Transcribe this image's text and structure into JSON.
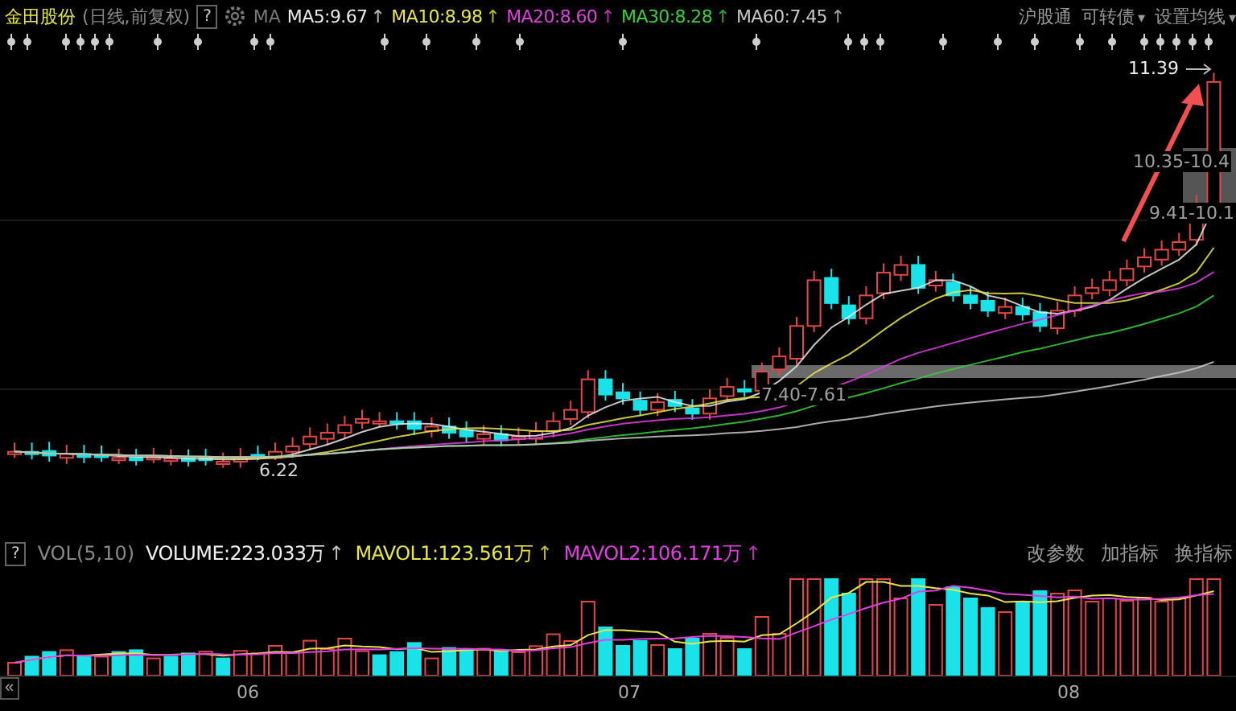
{
  "header": {
    "stock_name": "金田股份",
    "mode": "(日线,前复权)",
    "help": "?",
    "ma_label": "MA",
    "ma": [
      {
        "label": "MA5:9.67",
        "arrow": "↑",
        "color": "#e8e8e8"
      },
      {
        "label": "MA10:8.98",
        "arrow": "↑",
        "color": "#e6e64a"
      },
      {
        "label": "MA20:8.60",
        "arrow": "↑",
        "color": "#e040e0"
      },
      {
        "label": "MA30:8.28",
        "arrow": "↑",
        "color": "#3ad03a"
      },
      {
        "label": "MA60:7.45",
        "arrow": "↑",
        "color": "#c8c8c8"
      }
    ],
    "links": [
      {
        "label": "沪股通"
      },
      {
        "label": "可转债",
        "caret": "▾"
      },
      {
        "label": "设置均线",
        "caret": "▾"
      }
    ]
  },
  "price_labels": [
    {
      "kind": "high",
      "text": "11.39"
    },
    {
      "kind": "zone",
      "text": "10.35-10.4"
    },
    {
      "kind": "zone",
      "text": "9.41-10.1"
    },
    {
      "kind": "zone",
      "text": "7.40-7.61"
    },
    {
      "kind": "low",
      "text": "6.22"
    }
  ],
  "volume_header": {
    "help": "?",
    "indicator": "VOL(5,10)",
    "items": [
      {
        "label": "VOLUME:223.033万",
        "arrow": "↑",
        "color": "#f0f0f0"
      },
      {
        "label": "MAVOL1:123.561万",
        "arrow": "↑",
        "color": "#e6e64a"
      },
      {
        "label": "MAVOL2:106.171万",
        "arrow": "↑",
        "color": "#e040e0"
      }
    ],
    "buttons": [
      "改参数",
      "加指标",
      "换指标"
    ]
  },
  "x_axis": {
    "back": "«",
    "labels": [
      "06",
      "07",
      "08"
    ]
  }
}
